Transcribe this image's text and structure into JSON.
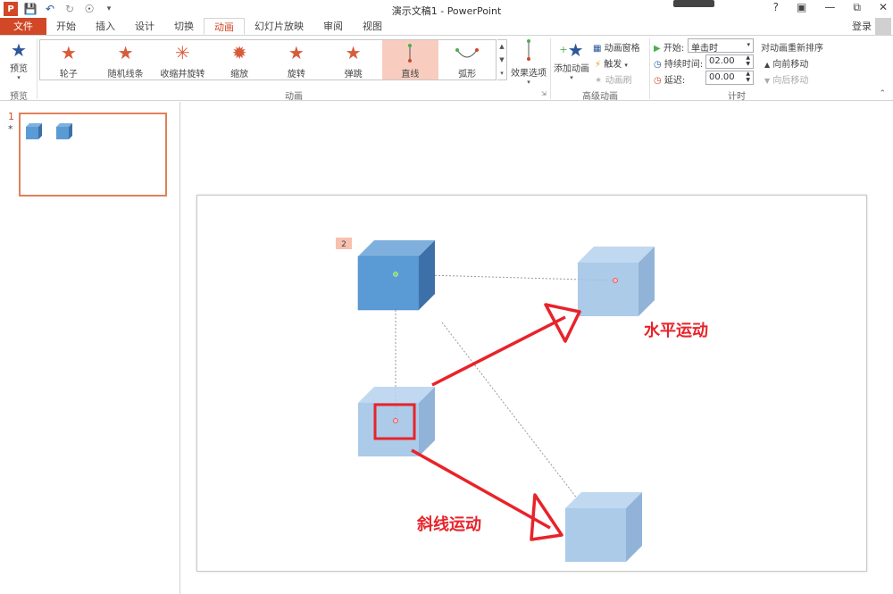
{
  "app": {
    "title": "演示文稿1 - PowerPoint",
    "help": "?",
    "login": "登录"
  },
  "tabs": [
    "文件",
    "开始",
    "插入",
    "设计",
    "切换",
    "动画",
    "幻灯片放映",
    "审阅",
    "视图"
  ],
  "ribbon": {
    "preview": {
      "label": "预览",
      "group": "预览"
    },
    "animations": {
      "group": "动画",
      "items": [
        {
          "label": "轮子",
          "selected": false
        },
        {
          "label": "随机线条",
          "selected": false
        },
        {
          "label": "收缩并旋转",
          "selected": false
        },
        {
          "label": "缩放",
          "selected": false
        },
        {
          "label": "旋转",
          "selected": false
        },
        {
          "label": "弹跳",
          "selected": false
        },
        {
          "label": "直线",
          "selected": true
        },
        {
          "label": "弧形",
          "selected": false
        }
      ],
      "effect_options": "效果选项"
    },
    "advanced": {
      "group": "高级动画",
      "add_animation": "添加动画",
      "pane": "动画窗格",
      "trigger": "触发",
      "painter": "动画刷"
    },
    "timing": {
      "group": "计时",
      "start_label": "开始:",
      "start_value": "单击时",
      "duration_label": "持续时间:",
      "duration_value": "02.00",
      "delay_label": "延迟:",
      "delay_value": "00.00",
      "reorder": "对动画重新排序",
      "move_earlier": "向前移动",
      "move_later": "向后移动"
    }
  },
  "thumbnail": {
    "number": "1",
    "star": "*"
  },
  "slide": {
    "badge": "2",
    "label_horizontal": "水平运动",
    "label_diagonal": "斜线运动"
  },
  "colors": {
    "accent": "#d24726",
    "cube_front": "#5b9bd5",
    "cube_light": "#9dc3e6",
    "arrow": "#e8232a"
  }
}
